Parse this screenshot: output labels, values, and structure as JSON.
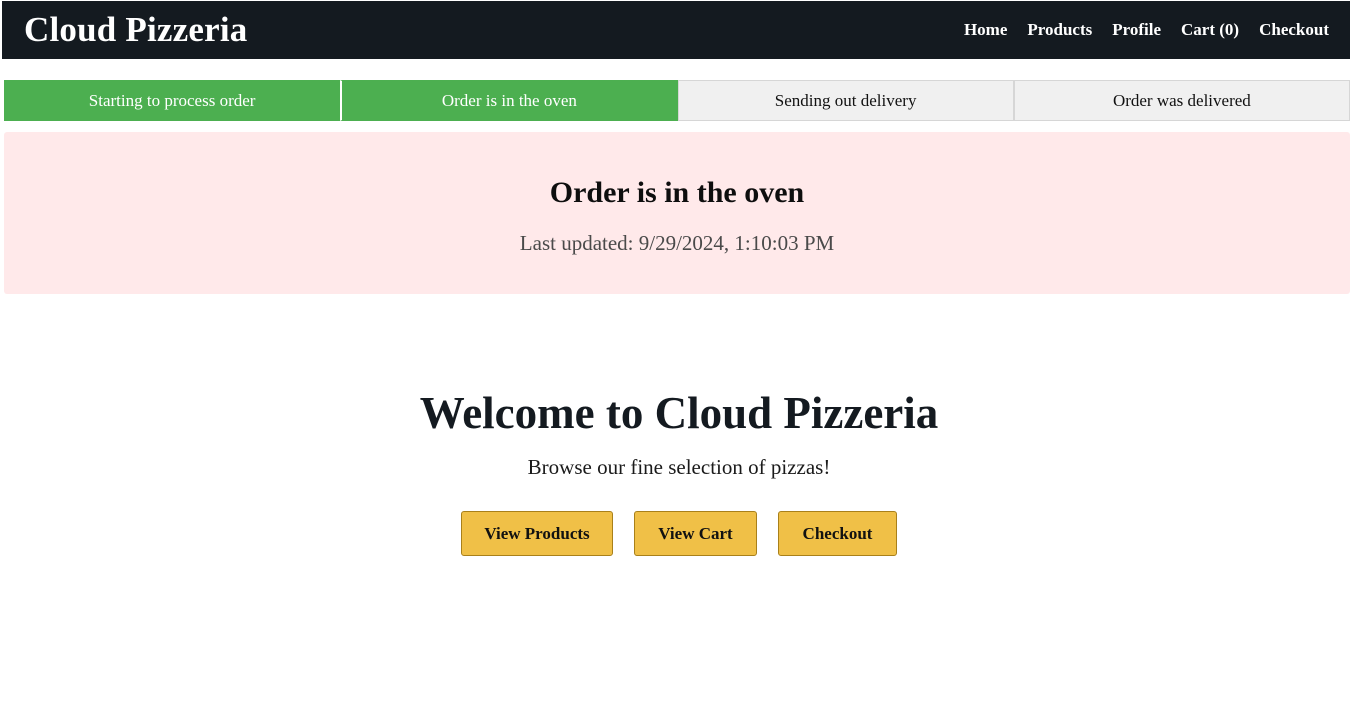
{
  "navbar": {
    "brand": "Cloud Pizzeria",
    "links": [
      "Home",
      "Products",
      "Profile",
      "Cart (0)",
      "Checkout"
    ]
  },
  "progress": {
    "steps": [
      {
        "label": "Starting to process order",
        "state": "complete"
      },
      {
        "label": "Order is in the oven",
        "state": "complete"
      },
      {
        "label": "Sending out delivery",
        "state": "pending"
      },
      {
        "label": "Order was delivered",
        "state": "pending"
      }
    ]
  },
  "status": {
    "title": "Order is in the oven",
    "last_updated": "Last updated: 9/29/2024, 1:10:03 PM"
  },
  "hero": {
    "title": "Welcome to Cloud Pizzeria",
    "subtitle": "Browse our fine selection of pizzas!",
    "buttons": {
      "products": "View Products",
      "cart": "View Cart",
      "checkout": "Checkout"
    }
  },
  "colors": {
    "navbar_bg": "#141a20",
    "step_complete": "#4caf50",
    "step_pending": "#f0f0f0",
    "status_panel_bg": "#ffe9ea",
    "button_bg": "#f0c047"
  }
}
